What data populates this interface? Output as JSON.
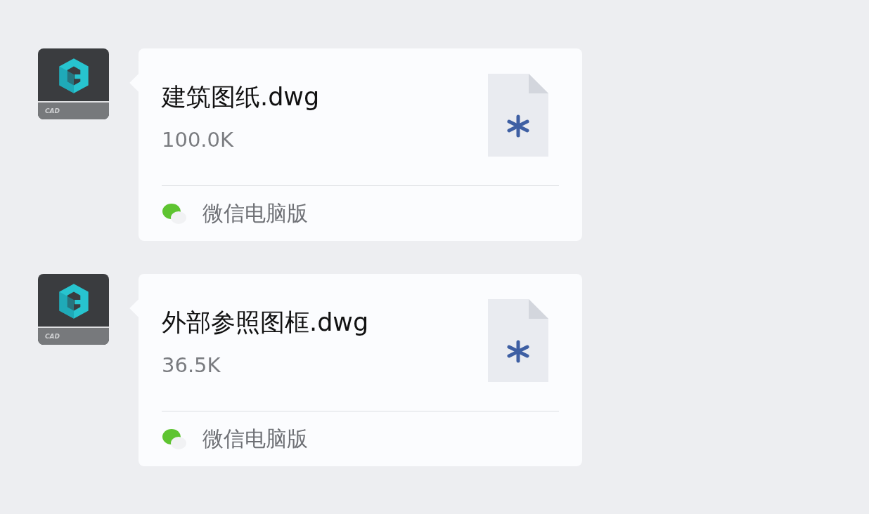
{
  "messages": [
    {
      "avatar_label": "CAD",
      "file_name": "建筑图纸.dwg",
      "file_size": "100.0K",
      "source": "微信电脑版"
    },
    {
      "avatar_label": "CAD",
      "file_name": "外部参照图框.dwg",
      "file_size": "36.5K",
      "source": "微信电脑版"
    }
  ]
}
